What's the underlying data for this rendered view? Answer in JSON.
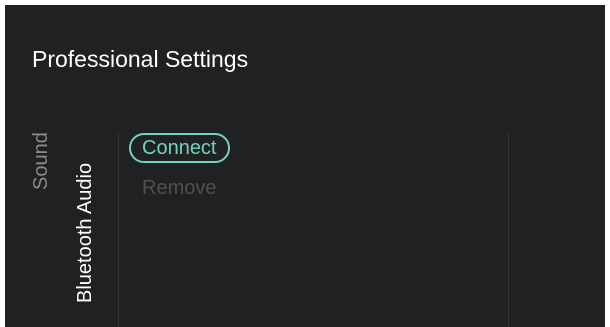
{
  "header": {
    "title": "Professional Settings"
  },
  "breadcrumb": {
    "parent": "Sound",
    "current": "Bluetooth Audio"
  },
  "menu": {
    "items": [
      {
        "label": "Connect",
        "state": "selected"
      },
      {
        "label": "Remove",
        "state": "disabled"
      }
    ]
  },
  "colors": {
    "background": "#202122",
    "accent": "#6fd3c3",
    "muted_text": "#8a8b8d",
    "disabled_text": "#4f5052"
  }
}
